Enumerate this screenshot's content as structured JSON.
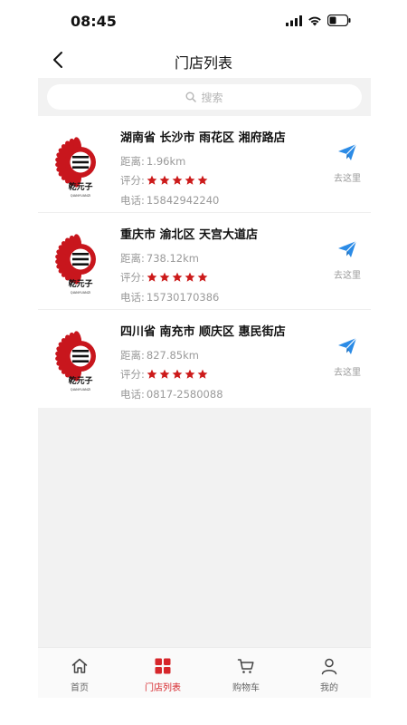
{
  "status_bar": {
    "time": "08:45"
  },
  "header": {
    "title": "门店列表"
  },
  "search": {
    "placeholder": "搜索"
  },
  "stores": [
    {
      "name": "湖南省 长沙市 雨花区 湘府路店",
      "distance_label": "距离:",
      "distance": "1.96km",
      "rating_label": "评分:",
      "rating": 5,
      "phone_label": "电话:",
      "phone": "15842942240",
      "go_label": "去这里"
    },
    {
      "name": "重庆市 渝北区 天宫大道店",
      "distance_label": "距离:",
      "distance": "738.12km",
      "rating_label": "评分:",
      "rating": 5,
      "phone_label": "电话:",
      "phone": "15730170386",
      "go_label": "去这里"
    },
    {
      "name": "四川省 南充市 顺庆区 惠民街店",
      "distance_label": "距离:",
      "distance": "827.85km",
      "rating_label": "评分:",
      "rating": 5,
      "phone_label": "电话:",
      "phone": "0817-2580088",
      "go_label": "去这里"
    }
  ],
  "logo": {
    "brand_text": "乾元子",
    "brand_pinyin": "QIANYUANZI",
    "color": "#c8161d"
  },
  "tabs": [
    {
      "label": "首页",
      "icon": "home-icon",
      "active": false
    },
    {
      "label": "门店列表",
      "icon": "store-list-icon",
      "active": true
    },
    {
      "label": "购物车",
      "icon": "cart-icon",
      "active": false
    },
    {
      "label": "我的",
      "icon": "profile-icon",
      "active": false
    }
  ],
  "colors": {
    "accent": "#d6262b",
    "star": "#cc1a1a",
    "send": "#2b8be6",
    "muted": "#9a9a9a"
  }
}
